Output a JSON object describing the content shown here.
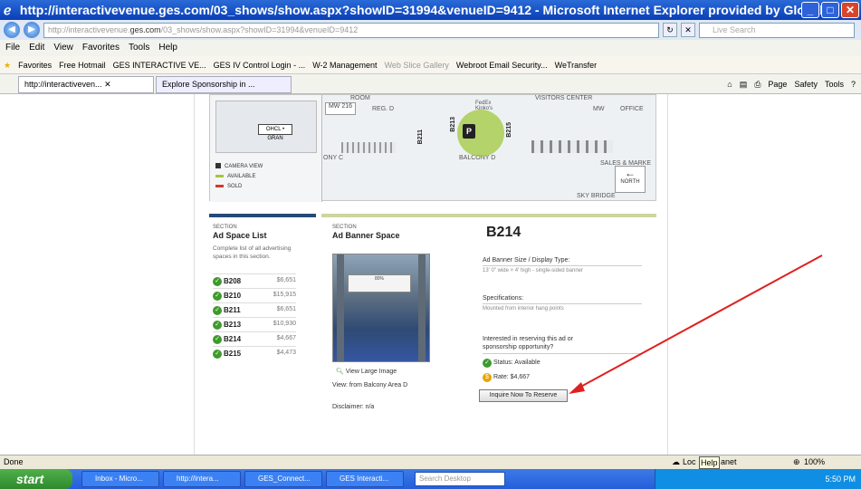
{
  "window": {
    "title": "http://interactivevenue.ges.com/03_shows/show.aspx?showID=31994&venueID=9412 - Microsoft Internet Explorer provided by Global E"
  },
  "address": {
    "prefix": "http://interactivevenue.",
    "host": "ges.com",
    "path": "/03_shows/show.aspx?showID=31994&venueID=9412",
    "search_placeholder": "Live Search"
  },
  "menu": [
    "File",
    "Edit",
    "View",
    "Favorites",
    "Tools",
    "Help"
  ],
  "favorites": {
    "label": "Favorites",
    "items": [
      "Free Hotmail",
      "GES INTERACTIVE VE...",
      "GES IV Control Login - ...",
      "W-2 Management",
      "Web Slice Gallery",
      "Webroot Email Security...",
      "WeTransfer"
    ]
  },
  "tabs": [
    "http://interactiveven...",
    "Explore Sponsorship in ..."
  ],
  "toolbar_right": [
    "Page",
    "Safety",
    "Tools"
  ],
  "map": {
    "labels": {
      "room": "ROOM",
      "mw216": "MW 216",
      "regd": "REG. D",
      "visitors": "VISITORS CENTER",
      "fedex": "FedEx Kinko's",
      "mw": "MW",
      "office": "OFFICE",
      "onyc": "ONY C",
      "balconyd": "BALCONY D",
      "sales": "SALES & MARKE",
      "skybridge": "SKY BRIDGE",
      "north": "NORTH",
      "b211": "B211",
      "b213": "B213",
      "b215": "B215",
      "pin": "P"
    },
    "minimap_label": "OHCL • GRAN",
    "legend": [
      {
        "label": "CAMERA VIEW",
        "color": "#333333"
      },
      {
        "label": "AVAILABLE",
        "color": "#a6c63b"
      },
      {
        "label": "SOLD",
        "color": "#d03a2a"
      }
    ]
  },
  "left_col": {
    "section": "SECTION",
    "title": "Ad Space List",
    "desc": "Complete list of all advertising spaces in this section."
  },
  "list": [
    {
      "name": "B208",
      "price": "$6,651"
    },
    {
      "name": "B210",
      "price": "$15,915"
    },
    {
      "name": "B211",
      "price": "$6,651"
    },
    {
      "name": "B213",
      "price": "$10,930"
    },
    {
      "name": "B214",
      "price": "$4,667"
    },
    {
      "name": "B215",
      "price": "$4,473"
    }
  ],
  "mid_col": {
    "section": "SECTION",
    "title": "Ad Banner Space",
    "banner_text": "80%",
    "view_large": "View Large Image",
    "view_from": "View: from Balcony Area D",
    "disclaimer": "Disclaimer: n/a"
  },
  "detail": {
    "title": "B214",
    "size_label": "Ad Banner Size / Display Type:",
    "size_value": "13' 0\" wide × 4' high - single-sided banner",
    "spec_label": "Specifications:",
    "spec_value": "Mounted from interior hang points",
    "interest": "Interested in reserving this ad or sponsorship opportunity?",
    "status": "Status: Available",
    "rate": "Rate: $4,667",
    "reserve_button": "Inquire Now To Reserve"
  },
  "statusbar": {
    "left": "Done",
    "loc": "Loc",
    "help": "Help",
    "anet": "anet",
    "zoom": "100%"
  },
  "taskbar": {
    "start": "start",
    "items": [
      "Inbox - Micro...",
      "http://intera...",
      "GES_Connect...",
      "GES Interacti..."
    ],
    "search": "Search Desktop",
    "time": "5:50 PM"
  },
  "colors": {
    "title_blue": "#0a3eb6",
    "available": "#a6c63b",
    "sold": "#d03a2a",
    "arrow": "#e02020"
  }
}
